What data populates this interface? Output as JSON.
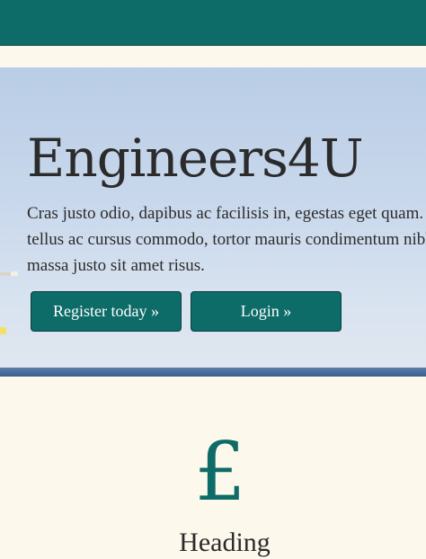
{
  "colors": {
    "accent": "#0d6b68",
    "page_background": "#fdf8ec",
    "text": "#2b2b2b"
  },
  "hero": {
    "title": "Engineers4U",
    "text_lines": [
      "Cras justo odio, dapibus ac facilisis in, egestas eget quam. Donec id elit non mi porta gravida at eget metus. Fusce dapibus,",
      "tellus ac cursus commodo, tortor mauris condimentum nibh, ut fermentum",
      "massa justo sit amet risus."
    ],
    "register_label": "Register today »",
    "login_label": "Login »"
  },
  "feature": {
    "icon": "pound-sterling-icon",
    "icon_glyph": "£",
    "heading": "Heading"
  }
}
